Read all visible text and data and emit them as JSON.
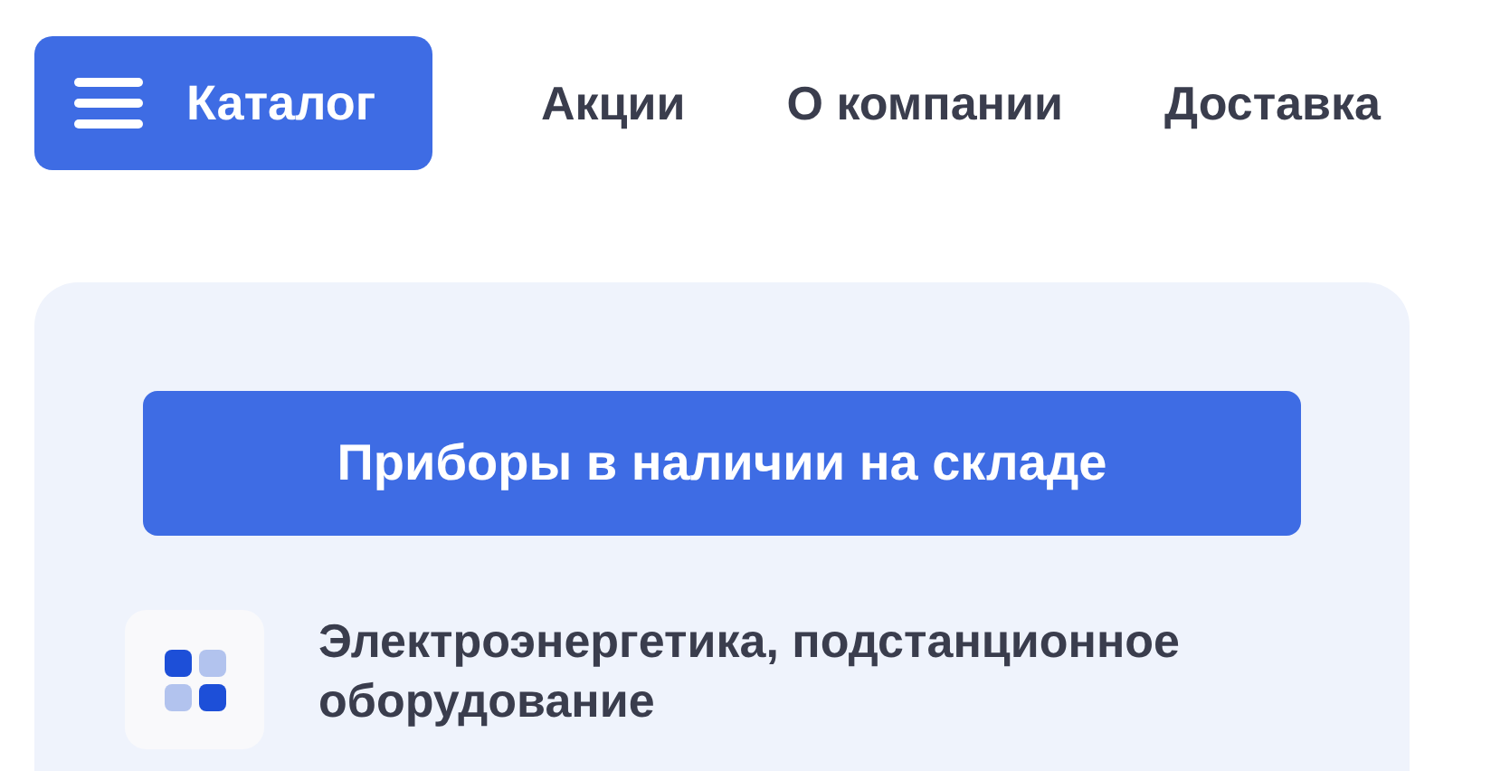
{
  "header": {
    "catalog_button": "Каталог",
    "nav": [
      "Акции",
      "О компании",
      "Доставка"
    ]
  },
  "panel": {
    "stock_button": "Приборы в наличии на складе",
    "categories": [
      {
        "title": "Электроэнергетика, подстанционное оборудование"
      }
    ]
  }
}
